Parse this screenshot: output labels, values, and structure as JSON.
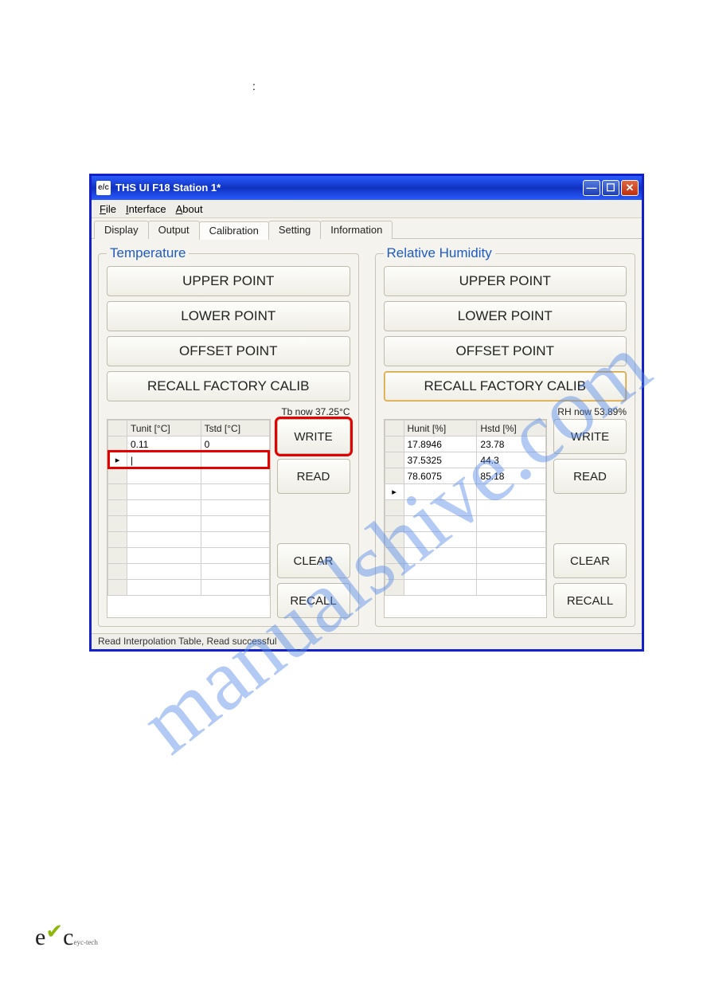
{
  "window": {
    "title": "THS UI F18  Station 1*",
    "logo_text": "e/c"
  },
  "menubar": [
    {
      "label": "File",
      "accel": "F"
    },
    {
      "label": "Interface",
      "accel": "I"
    },
    {
      "label": "About",
      "accel": "A"
    }
  ],
  "tabs": [
    "Display",
    "Output",
    "Calibration",
    "Setting",
    "Information"
  ],
  "active_tab": "Calibration",
  "temperature": {
    "legend": "Temperature",
    "buttons": [
      "UPPER POINT",
      "LOWER POINT",
      "OFFSET POINT",
      "RECALL FACTORY CALIB"
    ],
    "status": "Tb now 37.25°C",
    "table": {
      "headers": [
        "Tunit [°C]",
        "Tstd [°C]"
      ],
      "rows": [
        [
          "0.11",
          "0"
        ],
        [
          "|",
          ""
        ],
        [
          "",
          ""
        ],
        [
          "",
          ""
        ],
        [
          "",
          ""
        ],
        [
          "",
          ""
        ],
        [
          "",
          ""
        ],
        [
          "",
          ""
        ],
        [
          "",
          ""
        ],
        [
          "",
          ""
        ]
      ],
      "editing_row": 1
    },
    "sidebtns": [
      "WRITE",
      "READ",
      "CLEAR",
      "RECALL"
    ]
  },
  "humidity": {
    "legend": "Relative Humidity",
    "buttons": [
      "UPPER POINT",
      "LOWER POINT",
      "OFFSET POINT",
      "RECALL FACTORY CALIB"
    ],
    "status": "RH now 53.89%",
    "table": {
      "headers": [
        "Hunit [%]",
        "Hstd [%]"
      ],
      "rows": [
        [
          "17.8946",
          "23.78"
        ],
        [
          "37.5325",
          "44.3"
        ],
        [
          "78.6075",
          "85.18"
        ],
        [
          "",
          ""
        ],
        [
          "",
          ""
        ],
        [
          "",
          ""
        ],
        [
          "",
          ""
        ],
        [
          "",
          ""
        ],
        [
          "",
          ""
        ],
        [
          "",
          ""
        ]
      ],
      "editing_row": 3,
      "selected_cell": {
        "row": 3,
        "col": 0
      }
    },
    "sidebtns": [
      "WRITE",
      "READ",
      "CLEAR",
      "RECALL"
    ]
  },
  "statusbar": "Read Interpolation Table,  Read successful",
  "watermark": "manualshive.com",
  "footer": {
    "brand": "e c",
    "sub": "eyc-tech"
  }
}
